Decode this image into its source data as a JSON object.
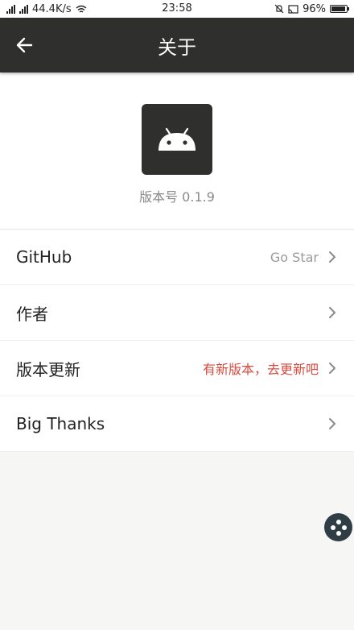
{
  "status_bar": {
    "network_speed": "44.4K/s",
    "time": "23:58",
    "battery_percent": "96%",
    "battery_level": 0.96
  },
  "toolbar": {
    "title": "关于"
  },
  "header": {
    "version": "版本号 0.1.9"
  },
  "list": {
    "items": [
      {
        "label": "GitHub",
        "value": "Go Star"
      },
      {
        "label": "作者",
        "value": ""
      },
      {
        "label": "版本更新",
        "value": "有新版本，去更新吧"
      },
      {
        "label": "Big Thanks",
        "value": ""
      }
    ]
  },
  "colors": {
    "toolbar_bg": "#2f2f2d",
    "alert_text": "#d94b3f",
    "secondary_text": "#9a9a9a",
    "page_bg": "#f6f6f4"
  },
  "icons": {
    "back": "arrow-left-icon",
    "logo": "android-icon",
    "chevron": "chevron-right-icon",
    "fab": "assistive-touch-icon"
  }
}
